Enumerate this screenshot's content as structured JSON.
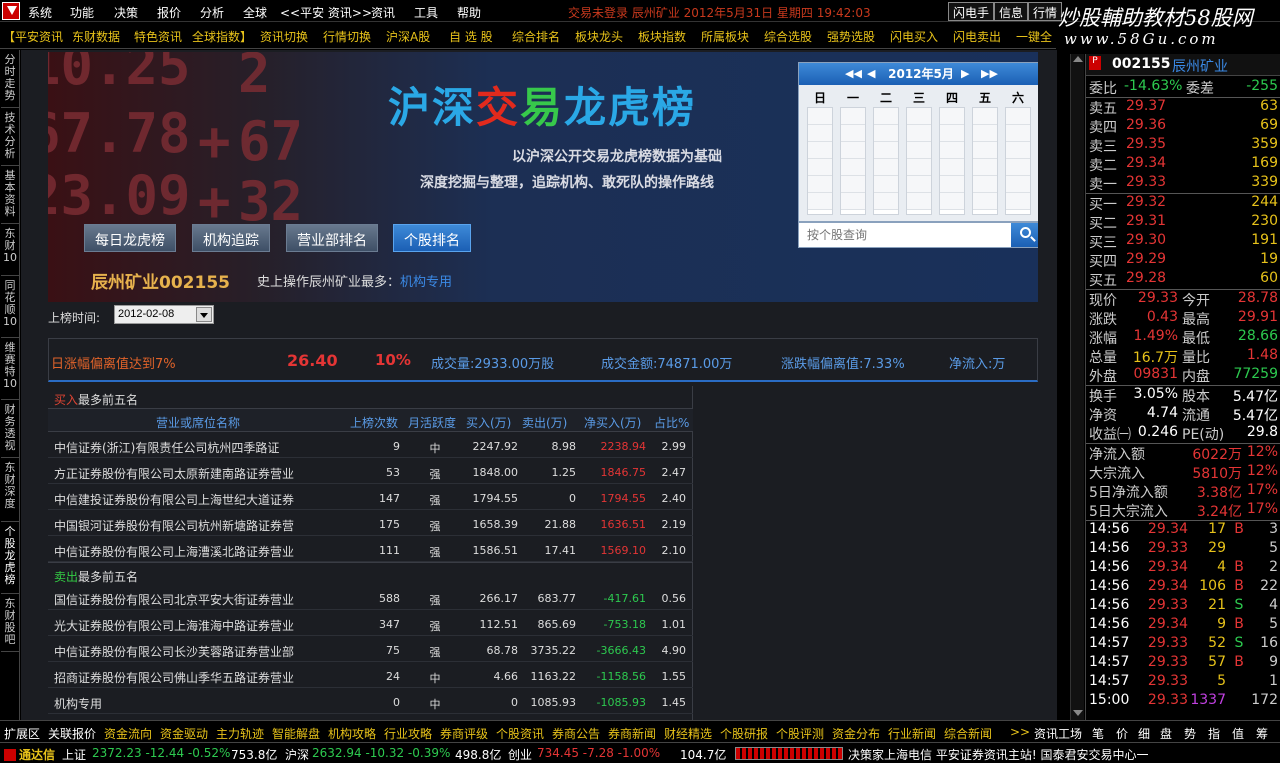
{
  "menu": {
    "items": [
      "系统",
      "功能",
      "决策",
      "报价",
      "分析",
      "全球",
      "<<平安 资讯>>",
      "资讯",
      "工具",
      "帮助"
    ],
    "notice": "交易未登录 辰州矿业 2012年5月31日 星期四 19:42:03",
    "top_buttons": [
      "闪电手",
      "信息",
      "行情"
    ]
  },
  "watermark": {
    "line1": "炒股輔助教材58股网",
    "line2": "www.58Gu.com"
  },
  "toolbar2": [
    "【平安资讯",
    "东财数据",
    "特色资讯",
    "全球指数】",
    "资讯切换",
    "行情切换",
    "沪深A股",
    "自 选 股",
    "综合排名",
    "板块龙头",
    "板块指数",
    "所属板块",
    "综合选股",
    "强势选股",
    "闪电买入",
    "闪电卖出",
    "一键全"
  ],
  "sidebar": [
    "分时走势",
    "技术分析",
    "基本资料",
    "东财10",
    "同花顺10",
    "维赛特10",
    "财务透视",
    "东财深度",
    "个股龙虎榜",
    "东财股吧"
  ],
  "banner": {
    "numbers": [
      "10.25",
      "2",
      "67.78",
      "+",
      "67",
      "23.09",
      "+",
      "32"
    ],
    "title_parts": [
      "沪深",
      "交",
      "易",
      "龙虎榜"
    ],
    "sub1": "以沪深公开交易龙虎榜数据为基础",
    "sub2": "深度挖掘与整理，追踪机构、敢死队的操作路线",
    "tabs": [
      "每日龙虎榜",
      "机构追踪",
      "营业部排名",
      "个股排名"
    ]
  },
  "calendar": {
    "month": "2012年5月",
    "weekdays": [
      "日",
      "一",
      "二",
      "三",
      "四",
      "五",
      "六"
    ]
  },
  "search": {
    "placeholder": "按个股查询"
  },
  "stock": {
    "title": "辰州矿业002155",
    "sub_prefix": "史上操作辰州矿业最多：",
    "sub_link": "机构专用"
  },
  "date": {
    "label": "上榜时间:",
    "value": "2012-02-08"
  },
  "stats": {
    "reason": "日涨幅偏离值达到7%",
    "value1": "26.40",
    "value2": "10%",
    "volume": "成交量:2933.00万股",
    "amount": "成交金额:74871.00万",
    "deviation": "涨跌幅偏离值:7.33%",
    "netflow": "净流入:万"
  },
  "buy_section": {
    "prefix": "买入",
    "suffix": "最多前五名"
  },
  "sell_section": {
    "prefix": "卖出",
    "suffix": "最多前五名"
  },
  "columns": [
    "营业或席位名称",
    "上榜次数",
    "月活跃度",
    "买入(万)",
    "卖出(万)",
    "净买入(万)",
    "占比%"
  ],
  "buy_rows": [
    [
      "中信证券(浙江)有限责任公司杭州四季路证",
      "9",
      "中",
      "2247.92",
      "8.98",
      "2238.94",
      "2.99"
    ],
    [
      "方正证券股份有限公司太原新建南路证券营业",
      "53",
      "强",
      "1848.00",
      "1.25",
      "1846.75",
      "2.47"
    ],
    [
      "中信建投证券股份有限公司上海世纪大道证券",
      "147",
      "强",
      "1794.55",
      "0",
      "1794.55",
      "2.40"
    ],
    [
      "中国银河证券股份有限公司杭州新塘路证券营",
      "175",
      "强",
      "1658.39",
      "21.88",
      "1636.51",
      "2.19"
    ],
    [
      "中信证券股份有限公司上海漕溪北路证券营业",
      "111",
      "强",
      "1586.51",
      "17.41",
      "1569.10",
      "2.10"
    ]
  ],
  "sell_rows": [
    [
      "国信证券股份有限公司北京平安大街证券营业",
      "588",
      "强",
      "266.17",
      "683.77",
      "-417.61",
      "0.56"
    ],
    [
      "光大证券股份有限公司上海淮海中路证券营业",
      "347",
      "强",
      "112.51",
      "865.69",
      "-753.18",
      "1.01"
    ],
    [
      "中信证券股份有限公司长沙芙蓉路证券营业部",
      "75",
      "强",
      "68.78",
      "3735.22",
      "-3666.43",
      "4.90"
    ],
    [
      "招商证券股份有限公司佛山季华五路证券营业",
      "24",
      "中",
      "4.66",
      "1163.22",
      "-1158.56",
      "1.55"
    ],
    [
      "机构专用",
      "0",
      "中",
      "0",
      "1085.93",
      "-1085.93",
      "1.45"
    ]
  ],
  "quote": {
    "code": "002155",
    "name": "辰州矿业",
    "weibi": {
      "label": "委比",
      "value": "-14.63%"
    },
    "weicha": {
      "label": "委差",
      "value": "-255"
    },
    "sells": [
      [
        "卖五",
        "29.37",
        "63"
      ],
      [
        "卖四",
        "29.36",
        "69"
      ],
      [
        "卖三",
        "29.35",
        "359"
      ],
      [
        "卖二",
        "29.34",
        "169"
      ],
      [
        "卖一",
        "29.33",
        "339"
      ]
    ],
    "buys": [
      [
        "买一",
        "29.32",
        "244"
      ],
      [
        "买二",
        "29.31",
        "230"
      ],
      [
        "买三",
        "29.30",
        "191"
      ],
      [
        "买四",
        "29.29",
        "19"
      ],
      [
        "买五",
        "29.28",
        "60"
      ]
    ],
    "info": [
      [
        "现价",
        "29.33",
        "今开",
        "28.78"
      ],
      [
        "涨跌",
        "0.43",
        "最高",
        "29.91"
      ],
      [
        "涨幅",
        "1.49%",
        "最低",
        "28.66"
      ],
      [
        "总量",
        "16.7万",
        "量比",
        "1.48"
      ],
      [
        "外盘",
        "09831",
        "内盘",
        "77259"
      ],
      [
        "换手",
        "3.05%",
        "股本",
        "5.47亿"
      ],
      [
        "净资",
        "4.74",
        "流通",
        "5.47亿"
      ],
      [
        "收益㈠",
        "0.246",
        "PE(动)",
        "29.8"
      ]
    ],
    "flows": [
      [
        "净流入额",
        "6022万",
        "12%"
      ],
      [
        "大宗流入",
        "5810万",
        "12%"
      ],
      [
        "5日净流入额",
        "3.38亿",
        "17%"
      ],
      [
        "5日大宗流入",
        "3.24亿",
        "17%"
      ]
    ],
    "ticks": [
      [
        "14:56",
        "29.34",
        "17",
        "B",
        "3"
      ],
      [
        "14:56",
        "29.33",
        "29",
        "",
        "5"
      ],
      [
        "14:56",
        "29.34",
        "4",
        "B",
        "2"
      ],
      [
        "14:56",
        "29.34",
        "106",
        "B",
        "22"
      ],
      [
        "14:56",
        "29.33",
        "21",
        "S",
        "4"
      ],
      [
        "14:56",
        "29.34",
        "9",
        "B",
        "5"
      ],
      [
        "14:57",
        "29.33",
        "52",
        "S",
        "16"
      ],
      [
        "14:57",
        "29.33",
        "57",
        "B",
        "9"
      ],
      [
        "14:57",
        "29.33",
        "5",
        "",
        "1"
      ],
      [
        "15:00",
        "29.33",
        "1337",
        "",
        "172"
      ]
    ]
  },
  "bottombar": [
    "扩展区",
    "关联报价",
    "资金流向",
    "资金驱动",
    "主力轨迹",
    "智能解盘",
    "机构攻略",
    "行业攻略",
    "券商评级",
    "个股资讯",
    "券商公告",
    "券商新闻",
    "财经精选",
    "个股研报",
    "个股评测",
    "资金分布",
    "行业新闻",
    "综合新闻",
    ">>",
    "资讯工场",
    "笔",
    "价",
    "细",
    "盘",
    "势",
    "指",
    "值",
    "筹"
  ],
  "statusbar": {
    "app": "通达信",
    "sh_label": "上证",
    "sh_values": "2372.23 -12.44 -0.52%",
    "sh_amount": "753.8亿",
    "sz_label": "沪深",
    "sz_values": "2632.94 -10.32 -0.39%",
    "sz_amount": "498.8亿",
    "cy_label": "创业",
    "cy_values": "734.45 -7.28 -1.00%",
    "cy_amount": "104.7亿",
    "right": "决策家上海电信 平安证券资讯主站! 国泰君安交易中心一"
  }
}
